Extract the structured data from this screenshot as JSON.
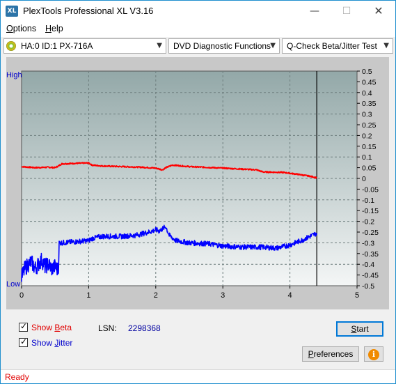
{
  "window": {
    "title": "PlexTools Professional XL V3.16",
    "icon_text": "XL",
    "minimize_glyph": "—",
    "maximize_glyph": "☐",
    "close_glyph": "✕"
  },
  "menu": {
    "items": [
      {
        "first": "O",
        "rest": "ptions"
      },
      {
        "first": "H",
        "rest": "elp"
      }
    ]
  },
  "toolbar": {
    "drive_select": "HA:0 ID:1  PX-716A",
    "function_select": "DVD Diagnostic Functions",
    "test_select": "Q-Check Beta/Jitter Test",
    "dropdown_glyph": "▼"
  },
  "chart_data": {
    "type": "line",
    "y_left_labels": {
      "top": "High",
      "bottom": "Low"
    },
    "x_ticks": [
      "0",
      "1",
      "2",
      "3",
      "4",
      "5"
    ],
    "xlim": [
      0,
      5
    ],
    "y_right_ticks": [
      "0.5",
      "0.45",
      "0.4",
      "0.35",
      "0.3",
      "0.25",
      "0.2",
      "0.15",
      "0.1",
      "0.05",
      "0",
      "-0.05",
      "-0.1",
      "-0.15",
      "-0.2",
      "-0.25",
      "-0.3",
      "-0.35",
      "-0.4",
      "-0.45",
      "-0.5"
    ],
    "ylim": [
      -0.5,
      0.5
    ],
    "end_marker_x": 4.4,
    "grid": true,
    "series": [
      {
        "name": "Beta",
        "color": "#ff0000",
        "x": [
          0.0,
          0.2,
          0.4,
          0.5,
          0.55,
          0.6,
          0.8,
          1.0,
          1.05,
          1.2,
          1.5,
          1.8,
          2.0,
          2.1,
          2.15,
          2.25,
          2.5,
          3.0,
          3.5,
          3.6,
          3.9,
          4.1,
          4.3,
          4.4
        ],
        "y": [
          0.055,
          0.05,
          0.052,
          0.05,
          0.058,
          0.068,
          0.07,
          0.072,
          0.062,
          0.058,
          0.055,
          0.052,
          0.048,
          0.04,
          0.05,
          0.062,
          0.055,
          0.048,
          0.04,
          0.03,
          0.028,
          0.02,
          0.01,
          0.003
        ]
      },
      {
        "name": "Jitter",
        "color": "#0000ff",
        "x": [
          0.0,
          0.05,
          0.1,
          0.15,
          0.2,
          0.25,
          0.3,
          0.35,
          0.4,
          0.45,
          0.5,
          0.55,
          0.56,
          0.6,
          0.8,
          1.0,
          1.05,
          1.2,
          1.5,
          1.7,
          1.9,
          2.0,
          2.05,
          2.1,
          2.15,
          2.2,
          2.3,
          2.5,
          2.8,
          3.0,
          3.3,
          3.6,
          3.8,
          4.0,
          4.2,
          4.3,
          4.4
        ],
        "y": [
          -0.46,
          -0.42,
          -0.4,
          -0.39,
          -0.42,
          -0.4,
          -0.38,
          -0.41,
          -0.4,
          -0.42,
          -0.41,
          -0.43,
          -0.3,
          -0.3,
          -0.295,
          -0.29,
          -0.28,
          -0.27,
          -0.27,
          -0.265,
          -0.25,
          -0.24,
          -0.245,
          -0.235,
          -0.225,
          -0.265,
          -0.29,
          -0.3,
          -0.305,
          -0.315,
          -0.32,
          -0.32,
          -0.325,
          -0.31,
          -0.285,
          -0.27,
          -0.255
        ]
      }
    ]
  },
  "controls": {
    "show_beta": {
      "checked": true,
      "first": "Show ",
      "mnemonic": "B",
      "rest": "eta"
    },
    "show_jitter": {
      "checked": true,
      "first": "Show ",
      "mnemonic": "J",
      "rest": "itter"
    },
    "lsn_label": "LSN:",
    "lsn_value": "2298368",
    "start_button": {
      "mnemonic": "S",
      "rest": "tart"
    },
    "preferences_button": {
      "first": "P",
      "rest": "references"
    },
    "info_glyph": "i",
    "checkmark_glyph": "✓"
  },
  "status": {
    "text": "Ready"
  },
  "colors": {
    "plot_top": "#93a8a8",
    "plot_bottom": "#f4f6f6",
    "beta": "#ff0000",
    "jitter": "#0000ff"
  }
}
